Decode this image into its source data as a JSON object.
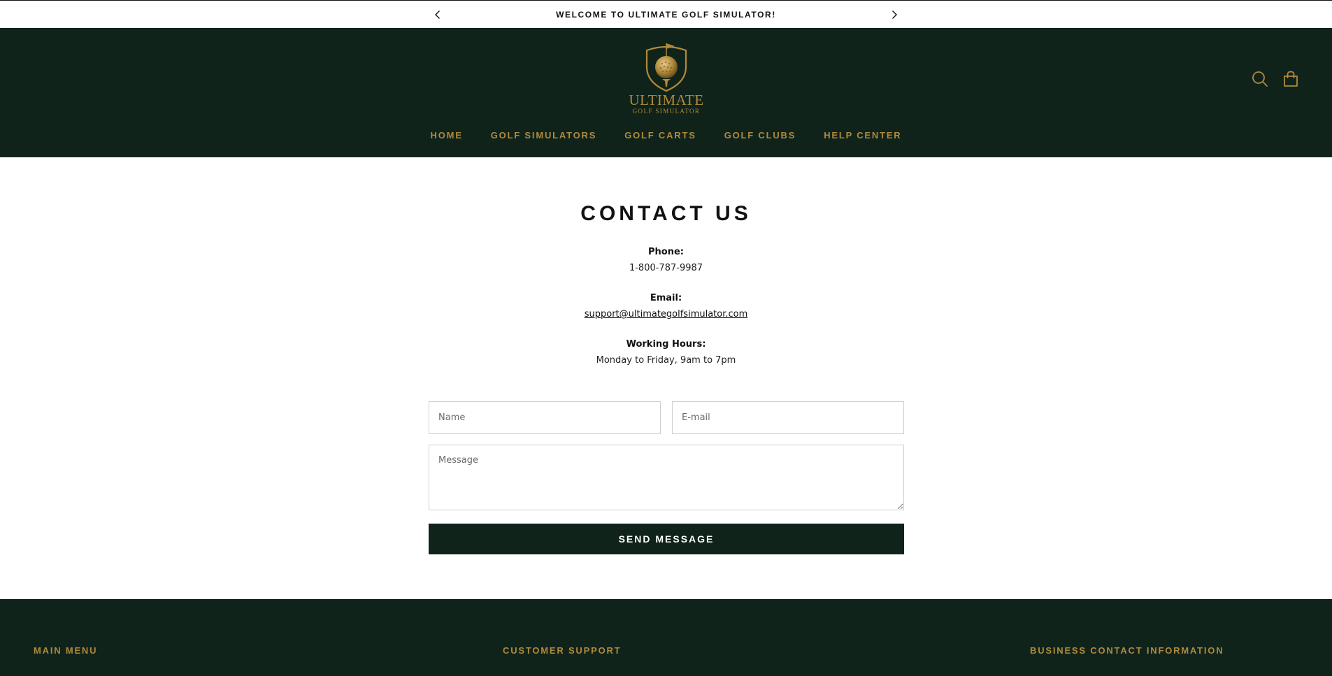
{
  "announcement": {
    "message": "WELCOME TO ULTIMATE GOLF SIMULATOR!"
  },
  "header": {
    "logo": {
      "brand": "ULTIMATE",
      "tagline": "GOLF SIMULATOR"
    },
    "icons": [
      "search-icon",
      "shopping-bag-icon"
    ],
    "nav": [
      {
        "label": "HOME"
      },
      {
        "label": "GOLF SIMULATORS"
      },
      {
        "label": "GOLF CARTS"
      },
      {
        "label": "GOLF CLUBS"
      },
      {
        "label": "HELP CENTER"
      }
    ]
  },
  "contact": {
    "title": "CONTACT US",
    "phone_label": "Phone:",
    "phone": "1-800-787-9987",
    "email_label": "Email:",
    "email": "support@ultimategolfsimulator.com",
    "hours_label": "Working Hours:",
    "hours": "Monday to Friday, 9am to 7pm",
    "form": {
      "name_placeholder": "Name",
      "email_placeholder": "E-mail",
      "message_placeholder": "Message",
      "submit_label": "SEND MESSAGE"
    }
  },
  "footer": {
    "columns": [
      {
        "title": "MAIN MENU"
      },
      {
        "title": "CUSTOMER SUPPORT"
      },
      {
        "title": "BUSINESS CONTACT INFORMATION"
      }
    ]
  },
  "colors": {
    "dark_green": "#10231b",
    "gold": "#b08a3a",
    "white": "#ffffff",
    "text": "#111111"
  }
}
